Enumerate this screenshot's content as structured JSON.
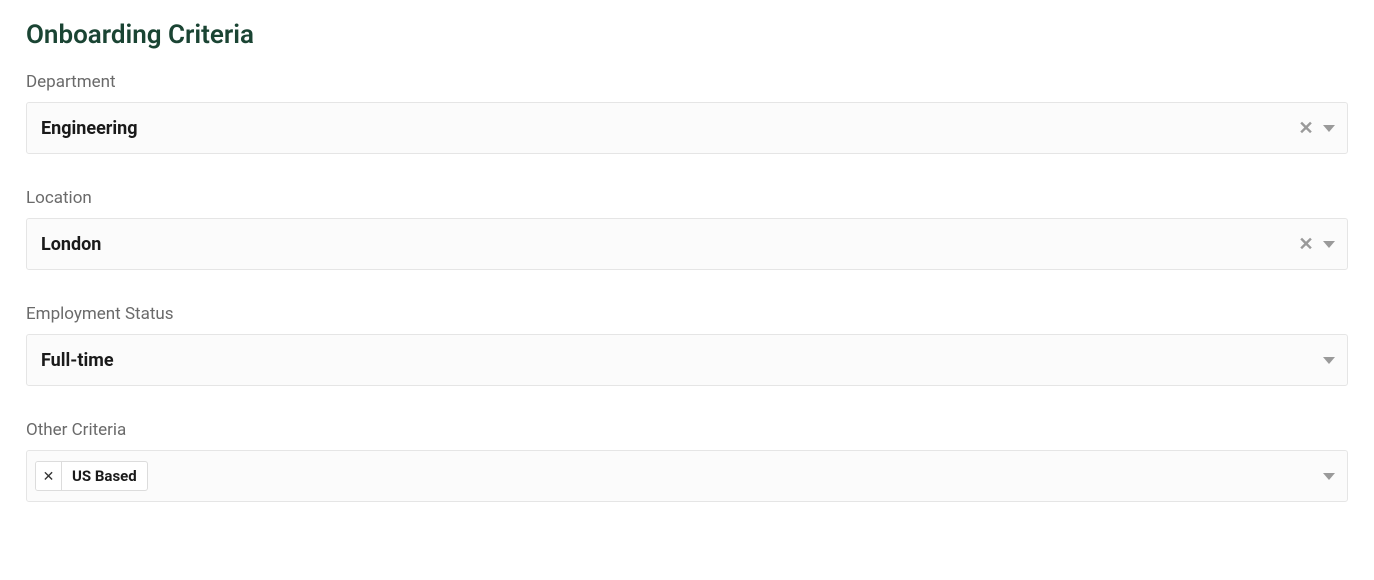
{
  "title": "Onboarding Criteria",
  "fields": {
    "department": {
      "label": "Department",
      "value": "Engineering",
      "clearable": true
    },
    "location": {
      "label": "Location",
      "value": "London",
      "clearable": true
    },
    "employment_status": {
      "label": "Employment Status",
      "value": "Full-time",
      "clearable": false
    },
    "other_criteria": {
      "label": "Other Criteria",
      "tags": [
        "US Based"
      ]
    }
  }
}
